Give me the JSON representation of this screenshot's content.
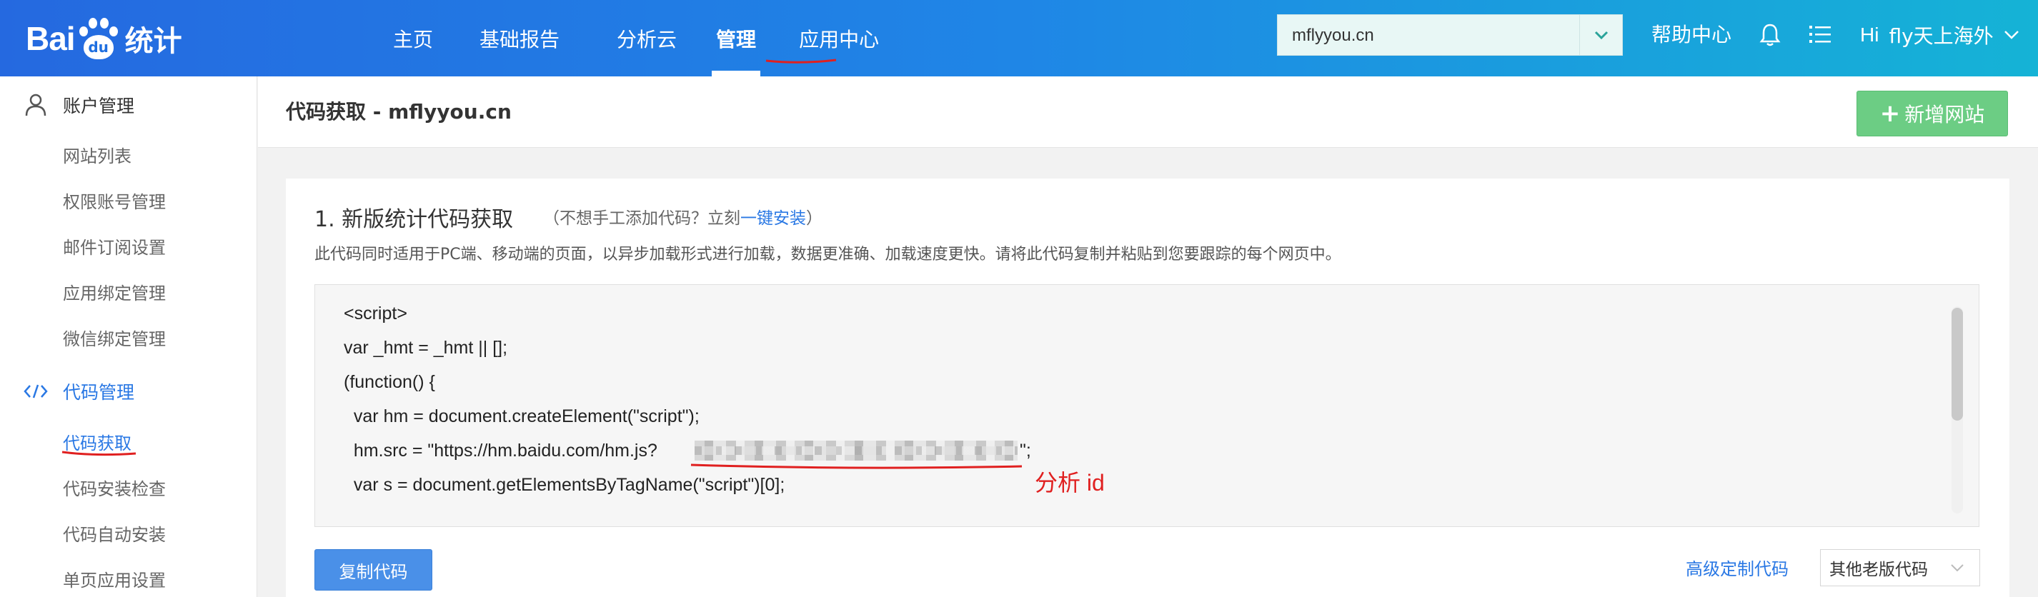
{
  "header": {
    "logo_word_left": "Bai",
    "logo_paw_text": "du",
    "logo_cn": "统计",
    "nav": [
      {
        "label": "主页",
        "active": false
      },
      {
        "label": "基础报告",
        "active": false
      },
      {
        "label": "分析云",
        "active": false
      },
      {
        "label": "管理",
        "active": true
      },
      {
        "label": "应用中心",
        "active": false
      }
    ],
    "site_select_value": "mflyyou.cn",
    "help_label": "帮助中心",
    "greeting": "Hi",
    "username": "fly天上海外"
  },
  "sidebar": {
    "groups": [
      {
        "label": "账户管理",
        "icon": "user-icon",
        "active": false
      },
      {
        "label": "代码管理",
        "icon": "code-icon",
        "active": true
      }
    ],
    "account_items": [
      "网站列表",
      "权限账号管理",
      "邮件订阅设置",
      "应用绑定管理",
      "微信绑定管理"
    ],
    "code_items": [
      "代码获取",
      "代码安装检查",
      "代码自动安装",
      "单页应用设置"
    ],
    "active_item": "代码获取"
  },
  "main": {
    "title": "代码获取 - mflyyou.cn",
    "add_site_label": "新增网站",
    "section_title": "1. 新版统计代码获取",
    "hint_prefix": "（不想手工添加代码？立刻",
    "hint_link": "一键安装",
    "hint_suffix": "）",
    "description": "此代码同时适用于PC端、移动端的页面，以异步加载形式进行加载，数据更准确、加载速度更快。请将此代码复制并粘贴到您要跟踪的每个网页中。",
    "code_lines": [
      "<script>",
      "var _hmt = _hmt || [];",
      "(function() {",
      "  var hm = document.createElement(\"script\");",
      "  hm.src = \"https://hm.baidu.com/hm.js?",
      "  var s = document.getElementsByTagName(\"script\")[0];"
    ],
    "code_line5_tail": "\";",
    "annotation": "分析 id",
    "copy_label": "复制代码",
    "advanced_label": "高级定制代码",
    "old_code_select": "其他老版代码"
  },
  "colors": {
    "header_start": "#2569e0",
    "header_end": "#15b3d6",
    "link_blue": "#2a78e4",
    "add_btn_green": "#6ccd84",
    "annotation_red": "#e02020"
  }
}
